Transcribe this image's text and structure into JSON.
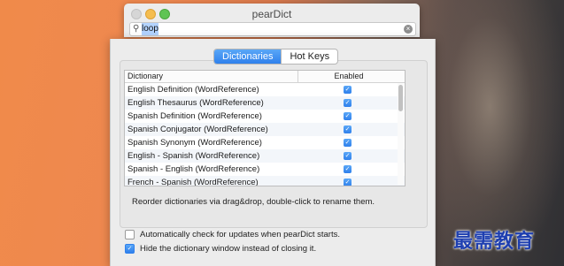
{
  "window": {
    "title": "pearDict",
    "search_value": "loop",
    "search_icon": "search-icon",
    "clear_icon": "clear-icon"
  },
  "prefs": {
    "tabs": [
      {
        "label": "Dictionaries",
        "active": true
      },
      {
        "label": "Hot Keys",
        "active": false
      }
    ],
    "table": {
      "columns": [
        "Dictionary",
        "Enabled"
      ],
      "rows": [
        {
          "name": "English Definition (WordReference)",
          "enabled": true
        },
        {
          "name": "English Thesaurus (WordReference)",
          "enabled": true
        },
        {
          "name": "Spanish Definition (WordReference)",
          "enabled": true
        },
        {
          "name": "Spanish Conjugator (WordReference)",
          "enabled": true
        },
        {
          "name": "Spanish Synonym (WordReference)",
          "enabled": true
        },
        {
          "name": "English - Spanish (WordReference)",
          "enabled": true
        },
        {
          "name": "Spanish - English (WordReference)",
          "enabled": true
        },
        {
          "name": "French - Spanish (WordReference)",
          "enabled": true
        }
      ]
    },
    "hint": "Reorder dictionaries via drag&drop, double-click to rename them.",
    "options": [
      {
        "label": "Automatically check for updates when pearDict starts.",
        "checked": false
      },
      {
        "label": "Hide the dictionary window instead of closing it.",
        "checked": true
      }
    ]
  },
  "watermark": "最需教育",
  "colors": {
    "accent": "#2f80ec",
    "watermark": "#1e3fb0"
  }
}
